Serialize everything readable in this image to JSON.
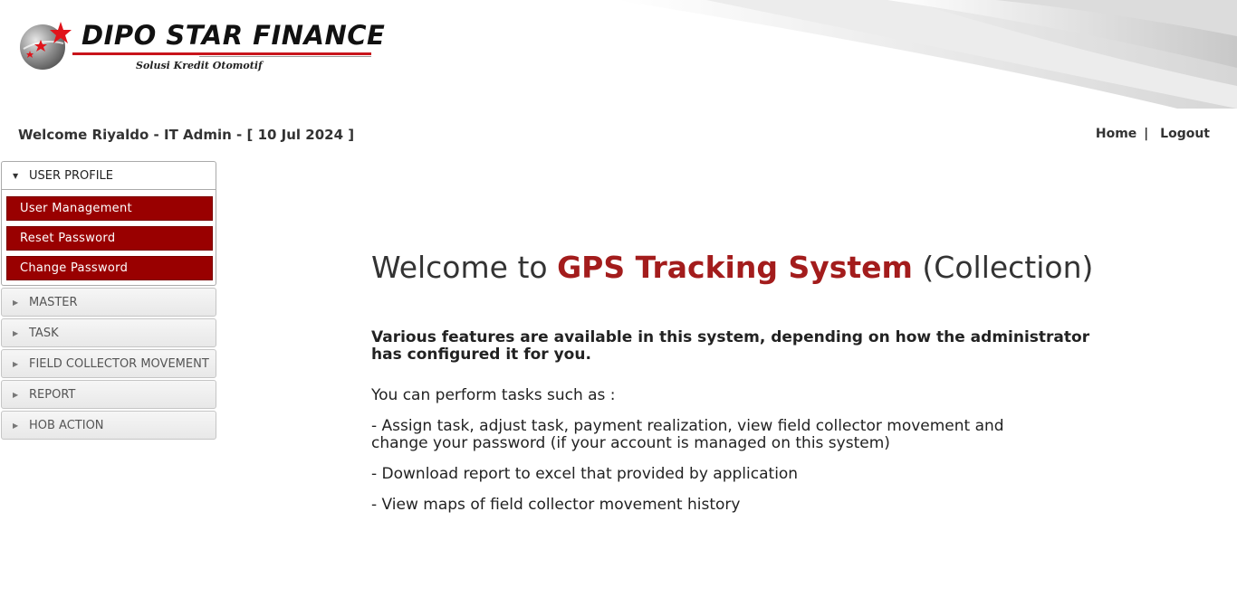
{
  "brand": {
    "name": "DIPO STAR FINANCE",
    "tagline": "Solusi Kredit Otomotif"
  },
  "header": {
    "welcome": "Welcome Riyaldo - IT Admin - [ 10 Jul 2024 ]",
    "links": {
      "home": "Home",
      "separator": "|",
      "logout": "Logout"
    }
  },
  "sidebar": {
    "sections": [
      {
        "label": "USER PROFILE",
        "expanded": true,
        "items": [
          "User Management",
          "Reset Password",
          "Change Password"
        ]
      },
      {
        "label": "MASTER",
        "expanded": false
      },
      {
        "label": "TASK",
        "expanded": false
      },
      {
        "label": "FIELD COLLECTOR MOVEMENT",
        "expanded": false
      },
      {
        "label": "REPORT",
        "expanded": false
      },
      {
        "label": "HOB ACTION",
        "expanded": false
      }
    ]
  },
  "main": {
    "title_prefix": "Welcome to",
    "title_brand": "GPS Tracking System",
    "title_suffix": "(Collection)",
    "features_text": "Various features are available in this system, depending on how the administrator has configured it for you.",
    "perform_text": "You can perform tasks such as :",
    "bullets": [
      "- Assign task, adjust task, payment realization, view field collector movement and change your password (if your account is managed on this system)",
      "- Download report to excel that provided by application",
      "- View maps of field collector movement history"
    ]
  },
  "colors": {
    "accent": "#990000",
    "title_brand": "#a31c1c",
    "logo_star": "#e0141b"
  },
  "icons": {
    "expanded": "triangle-down-icon",
    "collapsed": "triangle-right-icon"
  }
}
